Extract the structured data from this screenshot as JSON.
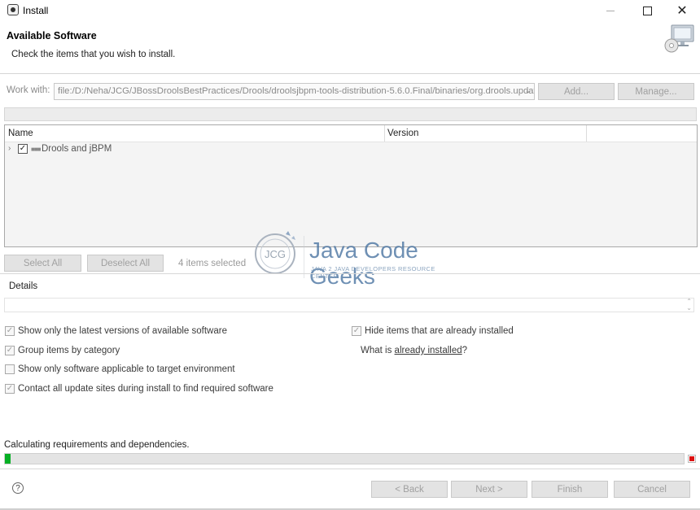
{
  "window": {
    "title": "Install",
    "icon": "eclipse-icon",
    "controls": {
      "minimize": "minimize-icon",
      "maximize": "maximize-icon",
      "close": "✕"
    }
  },
  "banner": {
    "title": "Available Software",
    "subtitle": "Check the items that you wish to install."
  },
  "work_with": {
    "label": "Work with:",
    "value": "file:/D:/Neha/JCG/JBossDroolsBestPractices/Drools/droolsjbpm-tools-distribution-5.6.0.Final/binaries/org.drools.updatesite/",
    "add_label": "Add...",
    "manage_label": "Manage..."
  },
  "table": {
    "columns": [
      "Name",
      "Version"
    ],
    "rows": [
      {
        "label": "Drools and jBPM",
        "version": "",
        "checked": true,
        "icon": "category-icon"
      }
    ]
  },
  "selection": {
    "select_all": "Select All",
    "deselect_all": "Deselect All",
    "count_text": "4 items selected"
  },
  "watermark": {
    "brand": "Java Code Geeks",
    "tagline": "JAVA 2 JAVA DEVELOPERS RESOURCE CENTER",
    "logo_text": "JCG"
  },
  "details": {
    "label": "Details",
    "value": ""
  },
  "options": {
    "latest_versions": {
      "label": "Show only the latest versions of available software",
      "checked": true
    },
    "group_by_category": {
      "label": "Group items by category",
      "checked": true
    },
    "target_env": {
      "label": "Show only software applicable to target environment",
      "checked": false
    },
    "contact_sites": {
      "label": "Contact all update sites during install to find required software",
      "checked": true
    },
    "hide_installed": {
      "label": "Hide items that are already installed",
      "checked": true
    },
    "what_is_prefix": "What is ",
    "already_installed_link": "already installed",
    "what_is_suffix": "?"
  },
  "status": {
    "text": "Calculating requirements and dependencies.",
    "progress": 0.008,
    "accent": "#06b025",
    "stop_color": "#dd1111"
  },
  "footer": {
    "back_label": "< Back",
    "next_label": "Next >",
    "finish_label": "Finish",
    "cancel_label": "Cancel"
  }
}
